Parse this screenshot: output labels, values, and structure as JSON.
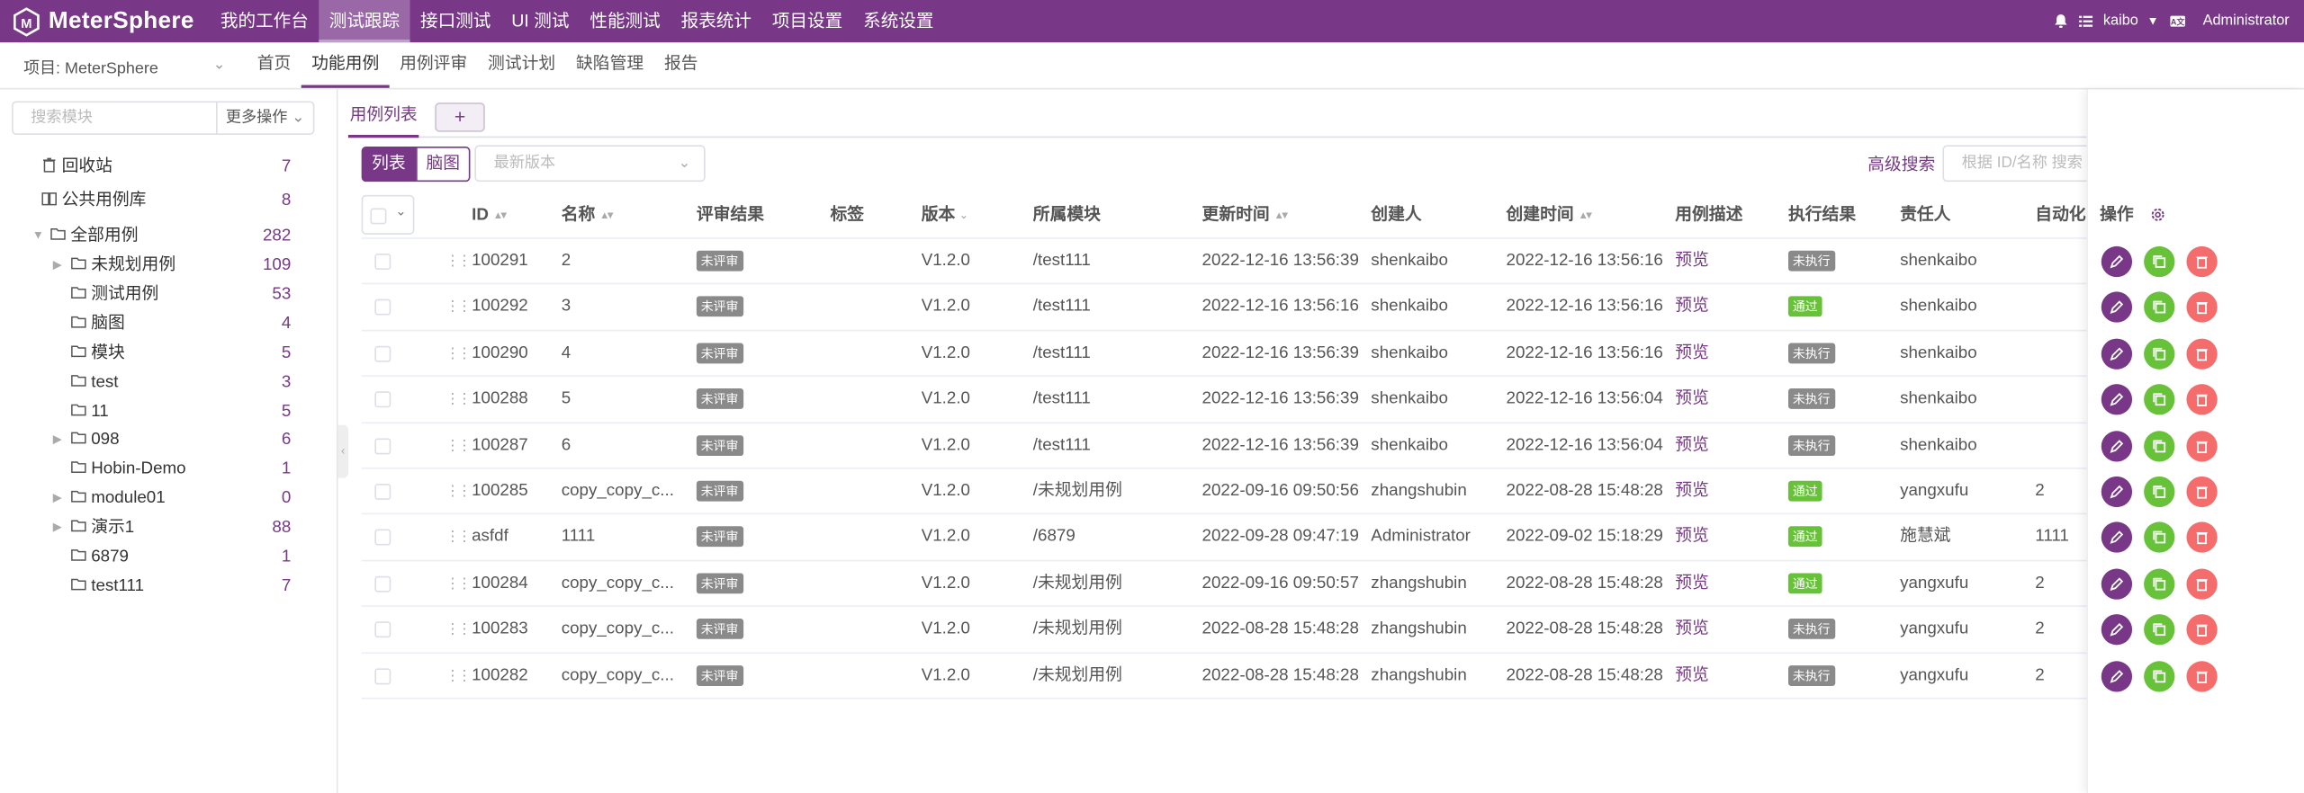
{
  "app": {
    "name": "MeterSphere",
    "brand_color": "#783887"
  },
  "topnav": [
    {
      "label": "我的工作台",
      "active": false
    },
    {
      "label": "测试跟踪",
      "active": true
    },
    {
      "label": "接口测试",
      "active": false
    },
    {
      "label": "UI 测试",
      "active": false
    },
    {
      "label": "性能测试",
      "active": false
    },
    {
      "label": "报表统计",
      "active": false
    },
    {
      "label": "项目设置",
      "active": false
    },
    {
      "label": "系统设置",
      "active": false
    }
  ],
  "topright": {
    "user": "kaibo",
    "lang_icon": "translate-icon",
    "account": "Administrator"
  },
  "project": {
    "label": "项目: MeterSphere"
  },
  "subnav": [
    {
      "label": "首页",
      "active": false
    },
    {
      "label": "功能用例",
      "active": true
    },
    {
      "label": "用例评审",
      "active": false
    },
    {
      "label": "测试计划",
      "active": false
    },
    {
      "label": "缺陷管理",
      "active": false
    },
    {
      "label": "报告",
      "active": false
    }
  ],
  "sidebar": {
    "search_placeholder": "搜索模块",
    "more_label": "更多操作",
    "trash": {
      "label": "回收站",
      "count": "7"
    },
    "public": {
      "label": "公共用例库",
      "count": "8"
    },
    "root": {
      "label": "全部用例",
      "count": "282"
    },
    "modules": [
      {
        "label": "未规划用例",
        "count": "109",
        "expandable": true
      },
      {
        "label": "测试用例",
        "count": "53",
        "expandable": false
      },
      {
        "label": "脑图",
        "count": "4",
        "expandable": false
      },
      {
        "label": "模块",
        "count": "5",
        "expandable": false
      },
      {
        "label": "test",
        "count": "3",
        "expandable": false
      },
      {
        "label": "11",
        "count": "5",
        "expandable": false
      },
      {
        "label": "098",
        "count": "6",
        "expandable": true
      },
      {
        "label": "Hobin-Demo",
        "count": "1",
        "expandable": false
      },
      {
        "label": "module01",
        "count": "0",
        "expandable": true
      },
      {
        "label": "演示1",
        "count": "88",
        "expandable": true
      },
      {
        "label": "6879",
        "count": "1",
        "expandable": false
      },
      {
        "label": "test111",
        "count": "7",
        "expandable": false
      }
    ]
  },
  "main": {
    "tab_label": "用例列表",
    "tab_add": "+",
    "view_list": "列表",
    "view_mind": "脑图",
    "version_placeholder": "最新版本",
    "advanced_search": "高级搜索",
    "search_placeholder": "根据 ID/名称 搜索"
  },
  "table": {
    "columns": [
      "ID",
      "名称",
      "评审结果",
      "标签",
      "版本",
      "所属模块",
      "更新时间",
      "创建人",
      "创建时间",
      "用例描述",
      "执行结果",
      "责任人",
      "自动化"
    ],
    "ops_header": "操作",
    "rows": [
      {
        "id": "100291",
        "name": "2",
        "review": "未评审",
        "tag": "",
        "version": "V1.2.0",
        "module": "/test111",
        "updated": "2022-12-16 13:56:39",
        "creator": "shenkaibo",
        "created": "2022-12-16 13:56:16",
        "desc": "预览",
        "result": "未执行",
        "owner": "shenkaibo",
        "auto": ""
      },
      {
        "id": "100292",
        "name": "3",
        "review": "未评审",
        "tag": "",
        "version": "V1.2.0",
        "module": "/test111",
        "updated": "2022-12-16 13:56:16",
        "creator": "shenkaibo",
        "created": "2022-12-16 13:56:16",
        "desc": "预览",
        "result": "通过",
        "owner": "shenkaibo",
        "auto": ""
      },
      {
        "id": "100290",
        "name": "4",
        "review": "未评审",
        "tag": "",
        "version": "V1.2.0",
        "module": "/test111",
        "updated": "2022-12-16 13:56:39",
        "creator": "shenkaibo",
        "created": "2022-12-16 13:56:16",
        "desc": "预览",
        "result": "未执行",
        "owner": "shenkaibo",
        "auto": ""
      },
      {
        "id": "100288",
        "name": "5",
        "review": "未评审",
        "tag": "",
        "version": "V1.2.0",
        "module": "/test111",
        "updated": "2022-12-16 13:56:39",
        "creator": "shenkaibo",
        "created": "2022-12-16 13:56:04",
        "desc": "预览",
        "result": "未执行",
        "owner": "shenkaibo",
        "auto": ""
      },
      {
        "id": "100287",
        "name": "6",
        "review": "未评审",
        "tag": "",
        "version": "V1.2.0",
        "module": "/test111",
        "updated": "2022-12-16 13:56:39",
        "creator": "shenkaibo",
        "created": "2022-12-16 13:56:04",
        "desc": "预览",
        "result": "未执行",
        "owner": "shenkaibo",
        "auto": ""
      },
      {
        "id": "100285",
        "name": "copy_copy_c...",
        "review": "未评审",
        "tag": "",
        "version": "V1.2.0",
        "module": "/未规划用例",
        "updated": "2022-09-16 09:50:56",
        "creator": "zhangshubin",
        "created": "2022-08-28 15:48:28",
        "desc": "预览",
        "result": "通过",
        "owner": "yangxufu",
        "auto": "2"
      },
      {
        "id": "asfdf",
        "name": "1111",
        "review": "未评审",
        "tag": "",
        "version": "V1.2.0",
        "module": "/6879",
        "updated": "2022-09-28 09:47:19",
        "creator": "Administrator",
        "created": "2022-09-02 15:18:29",
        "desc": "预览",
        "result": "通过",
        "owner": "施慧斌",
        "auto": "1111"
      },
      {
        "id": "100284",
        "name": "copy_copy_c...",
        "review": "未评审",
        "tag": "",
        "version": "V1.2.0",
        "module": "/未规划用例",
        "updated": "2022-09-16 09:50:57",
        "creator": "zhangshubin",
        "created": "2022-08-28 15:48:28",
        "desc": "预览",
        "result": "通过",
        "owner": "yangxufu",
        "auto": "2"
      },
      {
        "id": "100283",
        "name": "copy_copy_c...",
        "review": "未评审",
        "tag": "",
        "version": "V1.2.0",
        "module": "/未规划用例",
        "updated": "2022-08-28 15:48:28",
        "creator": "zhangshubin",
        "created": "2022-08-28 15:48:28",
        "desc": "预览",
        "result": "未执行",
        "owner": "yangxufu",
        "auto": "2"
      },
      {
        "id": "100282",
        "name": "copy_copy_c...",
        "review": "未评审",
        "tag": "",
        "version": "V1.2.0",
        "module": "/未规划用例",
        "updated": "2022-08-28 15:48:28",
        "creator": "zhangshubin",
        "created": "2022-08-28 15:48:28",
        "desc": "预览",
        "result": "未执行",
        "owner": "yangxufu",
        "auto": "2"
      }
    ]
  }
}
